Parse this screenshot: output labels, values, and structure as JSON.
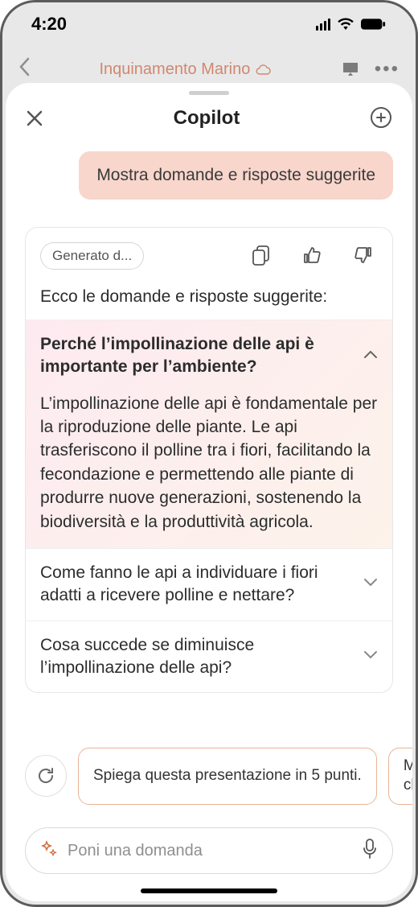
{
  "statusbar": {
    "time": "4:20"
  },
  "underlay": {
    "title": "Inquinamento Marino"
  },
  "sheet": {
    "title": "Copilot"
  },
  "user_message": "Mostra domande e risposte suggerite",
  "ai": {
    "chip": "Generato d...",
    "intro": "Ecco le domande e risposte suggerite:",
    "qa": [
      {
        "q": "Perché l’impollinazione delle api è importante per l’ambiente?",
        "a": "L’impollinazione delle api è fondamentale per la riproduzione delle piante. Le api trasferiscono il polline tra i fiori, facilitando la fecondazione e permettendo alle piante di produrre nuove generazioni, sostenendo la biodiversità e la produttività agricola.",
        "expanded": true
      },
      {
        "q": "Come fanno le api a individuare i fiori adatti a ricevere polline e nettare?",
        "expanded": false
      },
      {
        "q": "Cosa succede se diminuisce l’impollinazione delle api?",
        "expanded": false
      }
    ]
  },
  "suggestions": {
    "s1": "Spiega questa presentazione in 5 punti.",
    "s2": "Mostra diap chiave"
  },
  "input": {
    "placeholder": "Poni una domanda"
  }
}
